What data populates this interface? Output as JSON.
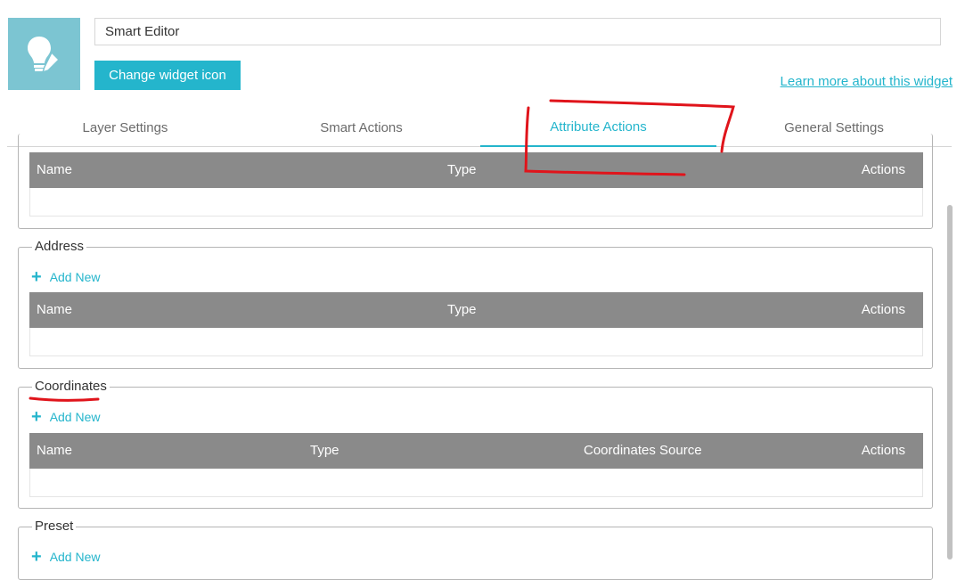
{
  "header": {
    "widget_name_value": "Smart Editor",
    "change_icon_label": "Change widget icon",
    "learn_more_label": "Learn more about this widget"
  },
  "tabs": [
    {
      "label": "Layer Settings",
      "active": false
    },
    {
      "label": "Smart Actions",
      "active": false
    },
    {
      "label": "Attribute Actions",
      "active": true
    },
    {
      "label": "General Settings",
      "active": false
    }
  ],
  "sections": {
    "top_table": {
      "columns": [
        "Name",
        "Type",
        "Actions"
      ]
    },
    "address": {
      "title": "Address",
      "add_new": "Add New",
      "columns": [
        "Name",
        "Type",
        "Actions"
      ]
    },
    "coordinates": {
      "title": "Coordinates",
      "add_new": "Add New",
      "columns": [
        "Name",
        "Type",
        "Coordinates Source",
        "Actions"
      ]
    },
    "preset": {
      "title": "Preset",
      "add_new": "Add New"
    }
  },
  "colors": {
    "accent": "#24b5cc",
    "icon_bg": "#7cc5d2",
    "grid_header": "#8a8a8a",
    "annotation": "#e0141b"
  },
  "icons": {
    "widget_icon": "lightbulb-pencil-icon",
    "add_icon": "plus-icon"
  }
}
